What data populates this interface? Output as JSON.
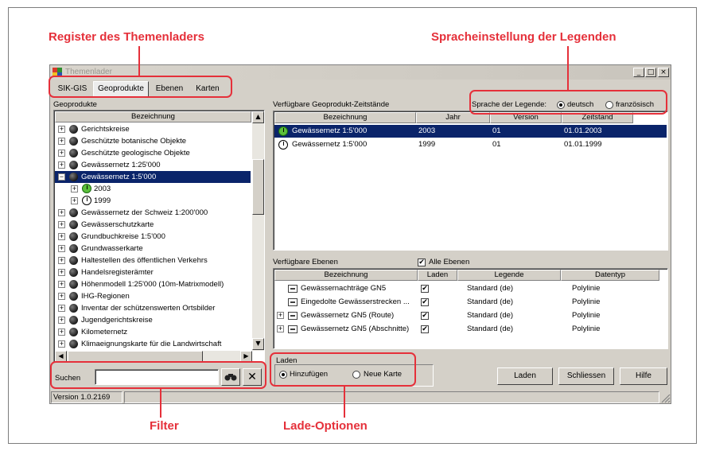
{
  "callouts": {
    "register": "Register des Themenladers",
    "sprache": "Spracheinstellung der Legenden",
    "filter": "Filter",
    "lade": "Lade-Optionen"
  },
  "window": {
    "title": "Themenlader",
    "controls": {
      "minimize": "_",
      "maximize": "□",
      "close": "×"
    }
  },
  "tabs": [
    "SIK-GIS",
    "Geoprodukte",
    "Ebenen",
    "Karten"
  ],
  "active_tab": "Geoprodukte",
  "geoprodukte": {
    "label": "Geoprodukte",
    "column": "Bezeichnung",
    "items": [
      {
        "label": "Gerichtskreise",
        "expander": "+",
        "icon": "globe-icon"
      },
      {
        "label": "Geschützte botanische Objekte",
        "expander": "+",
        "icon": "globe-icon"
      },
      {
        "label": "Geschützte geologische Objekte",
        "expander": "+",
        "icon": "globe-icon"
      },
      {
        "label": "Gewässernetz 1:25'000",
        "expander": "+",
        "icon": "globe-icon"
      },
      {
        "label": "Gewässernetz 1:5'000",
        "expander": "−",
        "icon": "globe-icon",
        "selected": true
      },
      {
        "label": "2003",
        "expander": "+",
        "icon": "clock-icon-green",
        "child": true
      },
      {
        "label": "1999",
        "expander": "+",
        "icon": "clock-icon",
        "child": true
      },
      {
        "label": "Gewässernetz der Schweiz 1:200'000",
        "expander": "+",
        "icon": "globe-icon"
      },
      {
        "label": "Gewässerschutzkarte",
        "expander": "+",
        "icon": "globe-icon"
      },
      {
        "label": "Grundbuchkreise 1:5'000",
        "expander": "+",
        "icon": "globe-icon"
      },
      {
        "label": "Grundwasserkarte",
        "expander": "+",
        "icon": "globe-icon"
      },
      {
        "label": "Haltestellen des öffentlichen Verkehrs",
        "expander": "+",
        "icon": "globe-icon"
      },
      {
        "label": "Handelsregisterämter",
        "expander": "+",
        "icon": "globe-icon"
      },
      {
        "label": "Höhenmodell 1:25'000 (10m-Matrixmodell)",
        "expander": "+",
        "icon": "globe-icon"
      },
      {
        "label": "IHG-Regionen",
        "expander": "+",
        "icon": "globe-icon"
      },
      {
        "label": "Inventar der schützenswerten Ortsbilder",
        "expander": "+",
        "icon": "globe-icon"
      },
      {
        "label": "Jugendgerichtskreise",
        "expander": "+",
        "icon": "globe-icon"
      },
      {
        "label": "Kilometernetz",
        "expander": "+",
        "icon": "globe-icon"
      },
      {
        "label": "Klimaeignungskarte für die Landwirtschaft",
        "expander": "+",
        "icon": "globe-icon"
      }
    ]
  },
  "zeitstaende": {
    "label": "Verfügbare Geoprodukt-Zeitstände",
    "columns": [
      "Bezeichnung",
      "Jahr",
      "Version",
      "Zeitstand"
    ],
    "rows": [
      {
        "cells": [
          "Gewässernetz 1:5'000",
          "2003",
          "01",
          "01.01.2003"
        ],
        "selected": true,
        "icon": "clock-icon-green"
      },
      {
        "cells": [
          "Gewässernetz 1:5'000",
          "1999",
          "01",
          "01.01.1999"
        ],
        "selected": false,
        "icon": "clock-icon"
      }
    ]
  },
  "sprache": {
    "label": "Sprache der Legende:",
    "options": [
      "deutsch",
      "französisch"
    ],
    "selected": "deutsch"
  },
  "ebenen": {
    "label": "Verfügbare Ebenen",
    "alle_label": "Alle Ebenen",
    "alle_checked": true,
    "columns": [
      "Bezeichnung",
      "Laden",
      "Legende",
      "Datentyp"
    ],
    "rows": [
      {
        "cells": [
          "Gewässernachträge GN5",
          "",
          "Standard (de)",
          "Polylinie"
        ],
        "checked": true,
        "expander": ""
      },
      {
        "cells": [
          "Eingedolte Gewässerstrecken ...",
          "",
          "Standard (de)",
          "Polylinie"
        ],
        "checked": true,
        "expander": ""
      },
      {
        "cells": [
          "Gewässernetz GN5 (Route)",
          "",
          "Standard (de)",
          "Polylinie"
        ],
        "checked": true,
        "expander": "+"
      },
      {
        "cells": [
          "Gewässernetz GN5 (Abschnitte)",
          "",
          "Standard (de)",
          "Polylinie"
        ],
        "checked": true,
        "expander": "+"
      }
    ]
  },
  "suchen": {
    "label": "Suchen",
    "value": "",
    "find_icon": "binoculars-icon",
    "clear_icon": "close-icon"
  },
  "laden": {
    "label": "Laden",
    "options": [
      "Hinzufügen",
      "Neue Karte"
    ],
    "selected": "Hinzufügen"
  },
  "buttons": {
    "laden": "Laden",
    "schliessen": "Schliessen",
    "hilfe": "Hilfe"
  },
  "status": {
    "version": "Version 1.0.2169"
  }
}
